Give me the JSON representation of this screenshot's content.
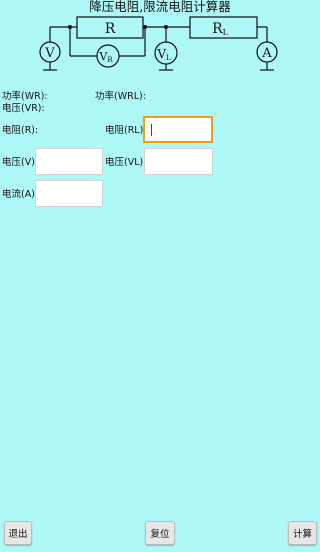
{
  "app": {
    "title": "降压电阻,限流电阻计算器"
  },
  "circuit": {
    "r_label": "R",
    "rl_label": "R",
    "rl_sub": "L",
    "v_meter": "V",
    "vr_meter": "V",
    "vr_sub": "R",
    "vl_meter": "V",
    "vl_sub": "L",
    "a_meter": "A"
  },
  "results": {
    "power_r_label": "功率(WR):",
    "power_rl_label": "功率(WRL):",
    "voltage_r_label": "电压(VR):"
  },
  "form": {
    "resistance_r_label": "电阻(R):",
    "resistance_rl_label": "电阻(RL):",
    "resistance_rl_value": "",
    "voltage_label": "电压(V):",
    "voltage_value": "",
    "voltage_l_label": "电压(VL):",
    "voltage_l_value": "",
    "current_label": "电流(A):",
    "current_value": ""
  },
  "buttons": {
    "exit": "退出",
    "reset": "复位",
    "calculate": "计算"
  },
  "colors": {
    "background": "#aef8f8",
    "focus_border": "#f29a1c"
  }
}
